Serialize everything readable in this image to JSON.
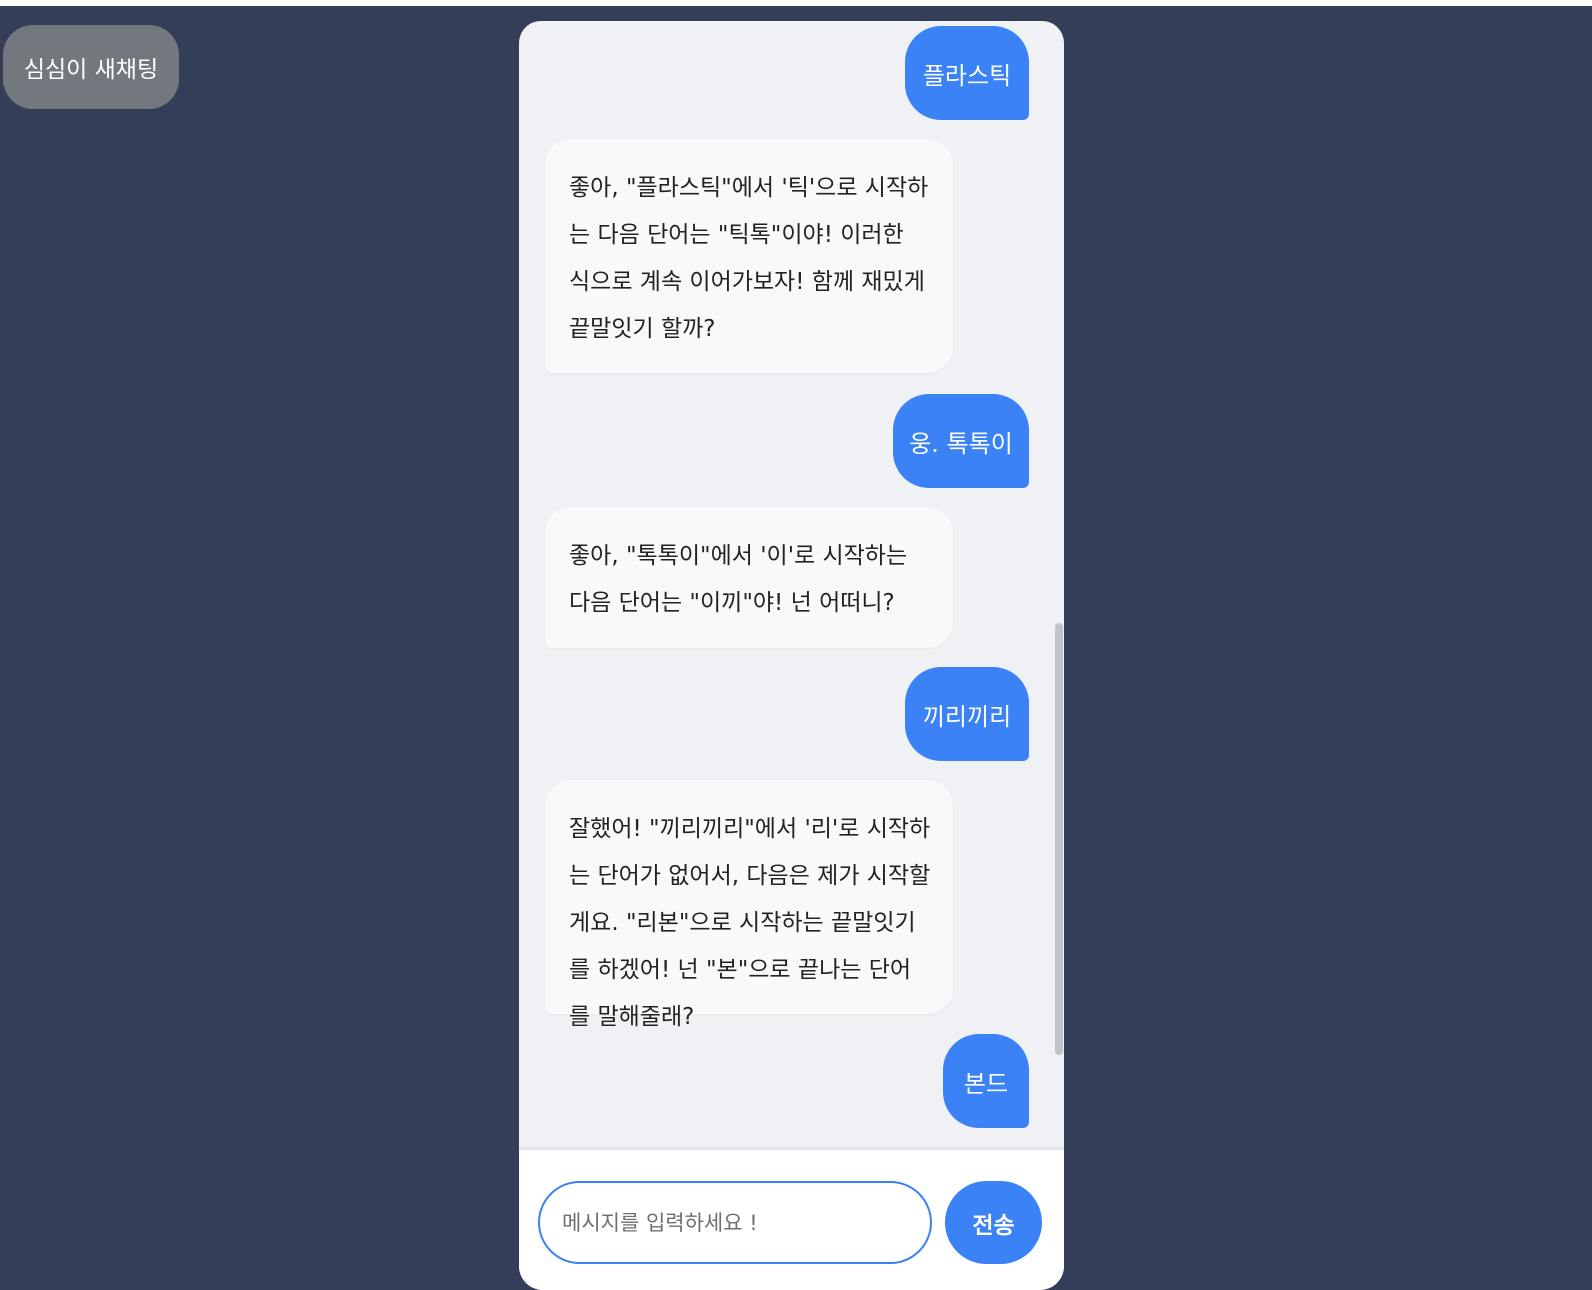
{
  "new_chat_label": "심심이 새채팅",
  "colors": {
    "background": "#353e58",
    "user_bubble": "#3b82f6",
    "bot_bubble": "#f8f9fb",
    "panel": "#f0f1f5",
    "new_chat_button": "#73787e"
  },
  "messages": [
    {
      "role": "user",
      "text": "플라스틱"
    },
    {
      "role": "bot",
      "text": "좋아, \"플라스틱\"에서 '틱'으로 시작하는 다음 단어는 \"틱톡\"이야! 이러한 식으로 계속 이어가보자! 함께 재밌게 끝말잇기 할까?"
    },
    {
      "role": "user",
      "text": "웅. 톡톡이"
    },
    {
      "role": "bot",
      "text": "좋아, \"톡톡이\"에서 '이'로 시작하는 다음 단어는 \"이끼\"야! 넌 어떠니?"
    },
    {
      "role": "user",
      "text": "끼리끼리"
    },
    {
      "role": "bot",
      "text": "잘했어! \"끼리끼리\"에서 '리'로 시작하는 단어가 없어서, 다음은 제가 시작할게요. \"리본\"으로 시작하는 끝말잇기를 하겠어! 넌 \"본\"으로 끝나는 단어를 말해줄래?"
    },
    {
      "role": "user",
      "text": "본드"
    }
  ],
  "composer": {
    "placeholder": "메시지를 입력하세요 !",
    "value": "",
    "send_label": "전송"
  }
}
